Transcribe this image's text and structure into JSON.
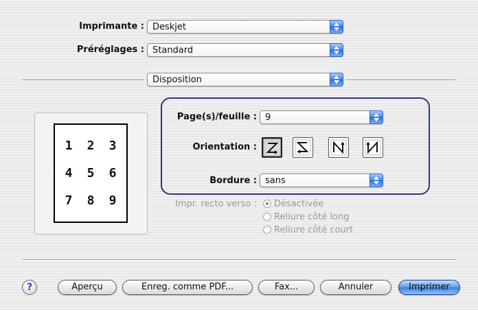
{
  "printer": {
    "label": "Imprimante :",
    "value": "Deskjet"
  },
  "presets": {
    "label": "Préréglages :",
    "value": "Standard"
  },
  "panel": {
    "value": "Disposition"
  },
  "preview": {
    "numbers": [
      "1",
      "2",
      "3",
      "4",
      "5",
      "6",
      "7",
      "8",
      "9"
    ]
  },
  "layout": {
    "pages_per_sheet": {
      "label": "Page(s)/feuille :",
      "value": "9"
    },
    "orientation": {
      "label": "Orientation :",
      "icons": [
        "orientation-z-icon",
        "orientation-reverse-z-icon",
        "orientation-n-icon",
        "orientation-reverse-n-icon"
      ],
      "selected_index": 0
    },
    "border": {
      "label": "Bordure :",
      "value": "sans"
    }
  },
  "duplex": {
    "label": "Impr. recto verso :",
    "options": [
      "Désactivée",
      "Reliure côté long",
      "Reliure côté court"
    ],
    "selected_index": 0
  },
  "buttons": {
    "help": "?",
    "preview": "Aperçu",
    "save_pdf": "Enreg. comme PDF...",
    "fax": "Fax...",
    "cancel": "Annuler",
    "print": "Imprimer"
  },
  "colors": {
    "accent": "#3c80df",
    "group_border": "#2a3580"
  }
}
